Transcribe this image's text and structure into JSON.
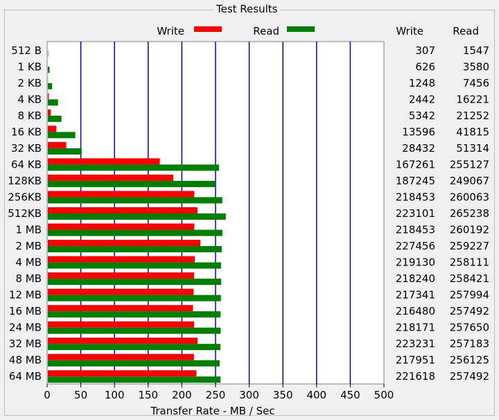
{
  "panel_title": "Test Results",
  "table": {
    "write_header": "Write",
    "read_header": "Read"
  },
  "colors": {
    "write": "#ff0000",
    "read": "#008000",
    "grid": "#0000c8"
  },
  "chart_data": {
    "type": "bar",
    "orientation": "horizontal",
    "categories": [
      "512 B",
      "1 KB",
      "2 KB",
      "4 KB",
      "8 KB",
      "16 KB",
      "32 KB",
      "64 KB",
      "128KB",
      "256KB",
      "512KB",
      "1 MB",
      "2 MB",
      "4 MB",
      "8 MB",
      "12 MB",
      "16 MB",
      "24 MB",
      "32 MB",
      "48 MB",
      "64 MB"
    ],
    "series": [
      {
        "name": "Write",
        "color": "#ff0000",
        "values": [
          307,
          626,
          1248,
          2442,
          5342,
          13596,
          28432,
          167261,
          187245,
          218453,
          223101,
          218453,
          227456,
          219130,
          218240,
          217341,
          216480,
          218171,
          223231,
          217951,
          221618
        ]
      },
      {
        "name": "Read",
        "color": "#008000",
        "values": [
          1547,
          3580,
          7456,
          16221,
          21252,
          41815,
          51314,
          255127,
          249067,
          260063,
          265238,
          260192,
          259227,
          258111,
          258421,
          257994,
          257492,
          257650,
          257183,
          256125,
          257492
        ]
      }
    ],
    "value_unit_divisor": 1000,
    "xlabel": "Transfer Rate - MB / Sec",
    "xlim": [
      0,
      500
    ],
    "xticks": [
      0,
      50,
      100,
      150,
      200,
      250,
      300,
      350,
      400,
      450,
      500
    ],
    "grid": true,
    "legend_position": "top"
  }
}
